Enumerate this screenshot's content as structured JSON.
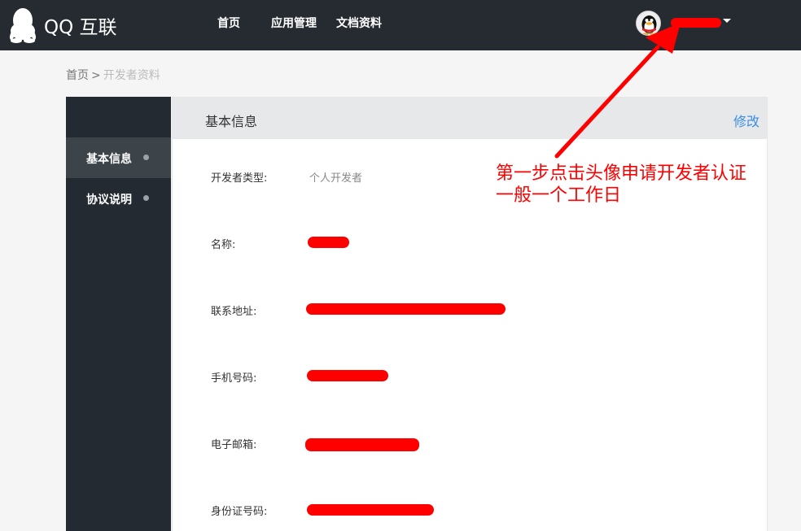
{
  "header": {
    "brand_text": "QQ 互联",
    "nav": [
      {
        "label": "首页"
      },
      {
        "label": "应用管理"
      },
      {
        "label": "文档资料"
      }
    ],
    "user": {
      "avatar_icon": "qq-penguin-avatar-icon",
      "name_redacted": true
    }
  },
  "breadcrumb": {
    "home": "首页",
    "separator": ">",
    "current": "开发者资料"
  },
  "sidebar": {
    "items": [
      {
        "label": "基本信息",
        "active": true
      },
      {
        "label": "协议说明",
        "active": false
      }
    ]
  },
  "panel": {
    "title": "基本信息",
    "edit_label": "修改",
    "fields": [
      {
        "label": "开发者类型:",
        "value": "个人开发者"
      },
      {
        "label": "名称:",
        "value_redacted": true
      },
      {
        "label": "联系地址:",
        "value_redacted": true
      },
      {
        "label": "手机号码:",
        "value_redacted": true
      },
      {
        "label": "电子邮箱:",
        "value_redacted": true
      },
      {
        "label": "身份证号码:",
        "value_redacted": true
      }
    ]
  },
  "annotation": {
    "line1": "第一步点击头像申请开发者认证",
    "line2": "一般一个工作日",
    "color": "#ff0000"
  },
  "colors": {
    "topbar": "#262b31",
    "sidebar": "#232a31",
    "sidebar_active": "#3c4349",
    "link": "#3a8ee6",
    "redaction": "#ff0000"
  }
}
